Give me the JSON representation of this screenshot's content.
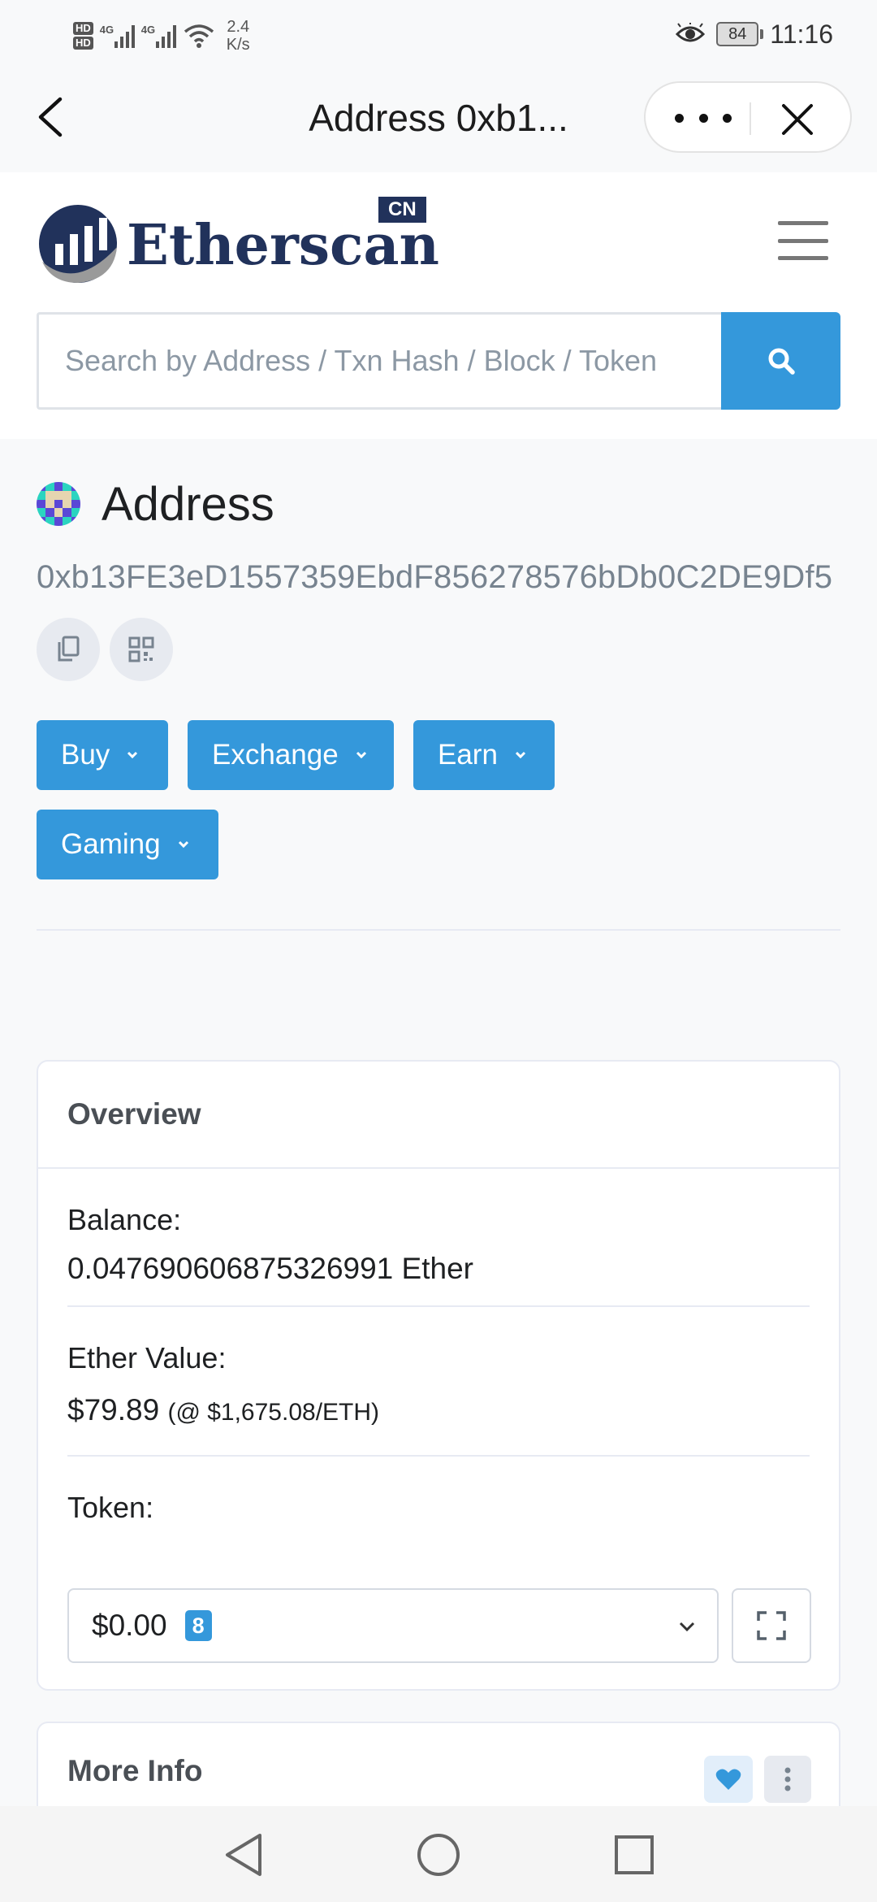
{
  "status_bar": {
    "hd1": "HD",
    "hd2": "HD",
    "net1": "4G",
    "net2": "4G",
    "speed_value": "2.4",
    "speed_unit": "K/s",
    "battery": "84",
    "time": "11:16"
  },
  "titlebar": {
    "title": "Address 0xb1..."
  },
  "header": {
    "logo_text": "Etherscan",
    "logo_badge": "CN",
    "search_placeholder": "Search by Address / Txn Hash / Block / Token"
  },
  "address": {
    "title": "Address",
    "hash": "0xb13FE3eD1557359EbdF856278576bDb0C2DE9Df5"
  },
  "actions": [
    {
      "label": "Buy"
    },
    {
      "label": "Exchange"
    },
    {
      "label": "Earn"
    },
    {
      "label": "Gaming"
    }
  ],
  "overview": {
    "title": "Overview",
    "balance_label": "Balance:",
    "balance_value": "0.047690606875326991 Ether",
    "ether_value_label": "Ether Value:",
    "ether_value": "$79.89",
    "ether_price": "(@ $1,675.08/ETH)",
    "token_label": "Token:",
    "token_value": "$0.00",
    "token_count": "8"
  },
  "more_info": {
    "title": "More Info"
  },
  "colors": {
    "accent": "#3498db",
    "brand_navy": "#21325b",
    "muted_text": "#77838f"
  }
}
